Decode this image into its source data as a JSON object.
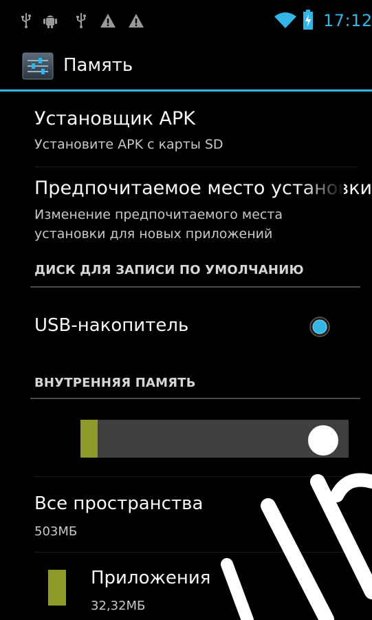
{
  "status_bar": {
    "time": "17:12",
    "notification_icons": [
      "usb-icon",
      "android-debug-icon",
      "usb-icon",
      "warning-icon",
      "warning-icon"
    ],
    "system_icons": [
      "wifi-icon",
      "battery-charging-icon"
    ],
    "accent_color": "#33b5e5"
  },
  "action_bar": {
    "title": "Память",
    "icon": "settings-sliders-icon"
  },
  "preferences": {
    "apk_installer": {
      "title": "Установщик APK",
      "summary": "Установите APK с карты SD"
    },
    "preferred_location": {
      "title": "Предпочитаемое место установки",
      "summary_line1": "Изменение предпочитаемого места",
      "summary_line2": "установки для новых приложений"
    },
    "default_write_disk": {
      "header": "ДИСК ДЛЯ ЗАПИСИ ПО УМОЛЧАНИЮ",
      "option_label": "USB-накопитель",
      "option_selected": true
    },
    "internal_storage": {
      "header": "ВНУТРЕННЯЯ ПАМЯТЬ",
      "usage_fraction": 0.064,
      "used_color": "#8e9b2a",
      "free_color": "#3f3f3f",
      "total": {
        "title": "Все пространства",
        "value": "503МБ"
      },
      "apps": {
        "title": "Приложения",
        "value": "32,32МБ",
        "color": "#8e9b2a"
      }
    }
  }
}
